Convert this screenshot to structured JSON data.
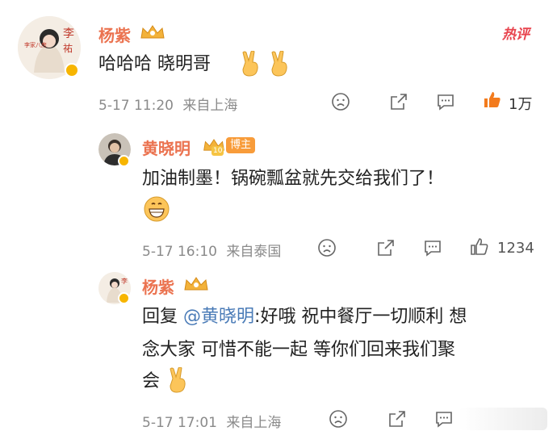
{
  "comments": [
    {
      "user": "杨紫",
      "avatar_text": "李\n祐",
      "avatar_sub": "家业 李家八房",
      "hot_label": "热评",
      "text": "哈哈哈 晓明哥",
      "emoji": [
        "victory-hand",
        "victory-hand"
      ],
      "time": "5-17 11:20",
      "location": "来自上海",
      "likes": "1万"
    },
    {
      "user": "黄晓明",
      "level": "10",
      "tag": "博主",
      "text": "加油制墨！锅碗瓢盆就先交给我们了！",
      "emoji": [
        "grinning-face"
      ],
      "time": "5-17 16:10",
      "location": "来自泰国",
      "likes": "1234"
    },
    {
      "user": "杨紫",
      "reply_prefix": "回复",
      "mention": "@黄晓明",
      "text_line1_rest": ":好哦 祝中餐厅一切顺利 想",
      "text_line2": "念大家 可惜不能一起 等你们回来我们聚",
      "text_line3": "会",
      "emoji": [
        "victory-hand"
      ],
      "time": "5-17 17:01",
      "location": "来自上海"
    }
  ],
  "colors": {
    "username": "#eb7350",
    "meta": "#8a8a8a",
    "mention": "#4a7bb7",
    "like_active": "#f37b1d"
  }
}
